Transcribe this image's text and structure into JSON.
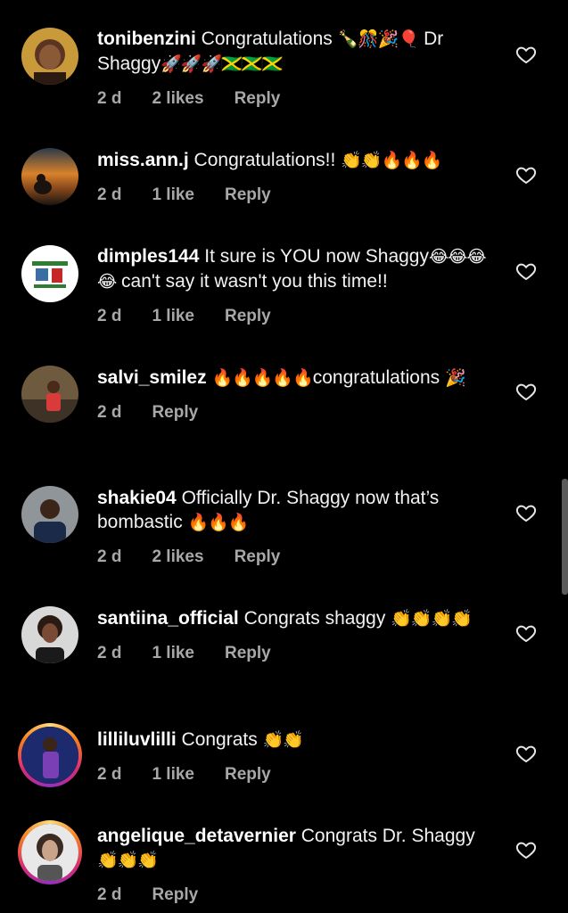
{
  "comments": [
    {
      "username": "tonibenzini",
      "text": "Congratulations",
      "emoji": "🍾🎊🎉🎈",
      "text2": "Dr Shaggy",
      "emoji2": "🚀🚀🚀🇯🇲🇯🇲🇯🇲",
      "time": "2 d",
      "likes": "2 likes",
      "reply": "Reply"
    },
    {
      "username": "miss.ann.j",
      "text": "Congratulations!!",
      "emoji": "👏👏🔥🔥🔥",
      "time": "2 d",
      "likes": "1 like",
      "reply": "Reply"
    },
    {
      "username": "dimples144",
      "text": "It sure is YOU now Shaggy",
      "emoji": "😂😂😂😂",
      "text2": "can't say it wasn't you this time!!",
      "time": "2 d",
      "likes": "1 like",
      "reply": "Reply"
    },
    {
      "username": "salvi_smilez",
      "emoji": "🔥🔥🔥🔥🔥",
      "text": "congratulations",
      "emoji2": "🎉",
      "time": "2 d",
      "reply": "Reply"
    },
    {
      "username": "shakie04",
      "text": "Officially Dr. Shaggy now that’s bombastic",
      "emoji": "🔥🔥🔥",
      "time": "2 d",
      "likes": "2 likes",
      "reply": "Reply"
    },
    {
      "username": "santiina_official",
      "text": "Congrats shaggy",
      "emoji": "👏👏👏👏",
      "time": "2 d",
      "likes": "1 like",
      "reply": "Reply"
    },
    {
      "username": "lilliluvlilli",
      "text": "Congrats",
      "emoji": "👏👏",
      "time": "2 d",
      "likes": "1 like",
      "reply": "Reply"
    },
    {
      "username": "angelique_detavernier",
      "text": "Congrats Dr. Shaggy",
      "emoji": "👏👏👏",
      "time": "2 d",
      "reply": "Reply"
    }
  ],
  "icons": {
    "like": "heart-outline-icon"
  },
  "colors": {
    "background": "#000000",
    "text": "#f2f2f2",
    "meta": "#a8a8a8",
    "story_ring": [
      "#feda75",
      "#fa7e1e",
      "#d62976",
      "#962fbf"
    ]
  }
}
